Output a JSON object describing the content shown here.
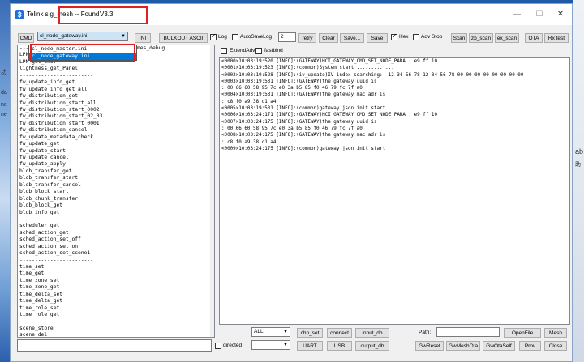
{
  "window": {
    "title": "Telink sig_mesh -- Found",
    "version": "V3.3"
  },
  "toolbar": {
    "cmd_label": "CMD",
    "ini_combo_value": "cl_node_gateway.ini",
    "ini_button": "INI",
    "bulkout_button": "BULKOUT ASCII",
    "log_label": "Log",
    "log_checked": true,
    "autosave_label": "AutoSaveLog",
    "autosave_checked": false,
    "autosave_value": "2",
    "retry_button": "retry",
    "clear_button": "Clear",
    "saveas_button": "Save...",
    "save_button": "Save",
    "hex_label": "Hex",
    "hex_checked": true,
    "advstop_label": "Adv Stop",
    "scan_button": "Scan",
    "zpscan_button": "zp_scan",
    "exscan_button": "ex_scan",
    "ota_button": "OTA",
    "rxtest_button": "Rx test"
  },
  "row2": {
    "extendadv_label": "ExtendAdv",
    "fastbind_label": "fastbind"
  },
  "popup": {
    "options": [
      "cl_node_master.ini",
      "cl_node_gateway.ini"
    ],
    "selected_index": 1
  },
  "list_peek": {
    "row0": "mes_debug"
  },
  "cmd_list": [
    "------------------------",
    "LPN set_onoff",
    "LPN get_onoff",
    "lightness_get_Panel",
    "------------------------",
    "fw_update_info_get",
    "fw_update_info_get_all",
    "fw_distribution_get",
    "fw_distribution_start_all",
    "fw_distribution_start_0002",
    "fw_distribution_start_02_03",
    "fw_distribution_start_0001",
    "fw_distribution_cancel",
    "fw_update_metadata_check",
    "fw_update_get",
    "fw_update_start",
    "fw_update_cancel",
    "fw_update_apply",
    "blob_transfer_get",
    "blob_transfer_start",
    "blob_transfer_cancel",
    "blob_block_start",
    "blob_chunk_transfer",
    "blob_block_get",
    "blob_info_get",
    "------------------------",
    "scheduler_get",
    "sched_action_get",
    "sched_action_set_off",
    "sched_action_set_on",
    "sched_action_set_scene1",
    "------------------------",
    "time_set",
    "time_get",
    "time_zone_set",
    "time_zone_get",
    "time_delta_set",
    "time_delta_get",
    "time_role_set",
    "time_role_get",
    "------------------------",
    "scene_store",
    "scene_del"
  ],
  "log_lines": [
    "<0000>10:03:19:520 [INFO]:(GATEWAY)HCI_GATEWAY_CMD_SET_NODE_PARA : e9 ff 10",
    "<0001>10:03:19:523 [INFO]:(common)System start .............",
    "<0002>10:03:19:528 [INFO]:(iv_update)IV index searching:: 12 34 56 78 12 34 56 78 00 00 00 00 00 00 00 00",
    "<0003>10:03:19:531 [INFO]:(GATEWAY)the gateway uuid is",
    ": 00 66 60 58 95 7c e0 3a b5 85 f0 46 79 fc 7f a0",
    "<0004>10:03:19:531 [INFO]:(GATEWAY)the gateway mac adr is",
    ": c8 f0 a9 38 c1 a4",
    "<0005>10:03:19:531 [INFO]:(common)gateway json init start",
    "<0006>10:03:24:171 [INFO]:(GATEWAY)HCI_GATEWAY_CMD_SET_NODE_PARA : e9 ff 10",
    "<0007>10:03:24:175 [INFO]:(GATEWAY)the gateway uuid is",
    ": 00 66 60 58 95 7c e0 3a b5 85 f0 46 79 fc 7f a0",
    "<0008>10:03:24:175 [INFO]:(GATEWAY)the gateway mac adr is",
    ": c8 f0 a9 38 c1 a4",
    "<0009>10:03:24:175 [INFO]:(common)gateway json init start"
  ],
  "bottom": {
    "filter_combo": "ALL",
    "chn_set_button": "chn_set",
    "connect_button": "connect",
    "input_db_button": "input_db",
    "path_label": "Path:",
    "openfile_button": "OpenFile",
    "mesh_button": "Mesh",
    "directed_label": "directed",
    "uart_button": "UART",
    "usb_button": "USB",
    "output_db_button": "output_db",
    "gwreset_button": "GwReset",
    "gwmeshota_button": "GwMeshOta",
    "gwotaself_button": "GwOtaSelf",
    "prov_button": "Prov",
    "close_button": "Close"
  },
  "desktop_fragments": {
    "left": [
      "da",
      "ne",
      "ne",
      "功"
    ],
    "right": [
      "ab",
      "助"
    ]
  },
  "colors": {
    "highlight": "#e02020",
    "selection": "#0078d7"
  }
}
